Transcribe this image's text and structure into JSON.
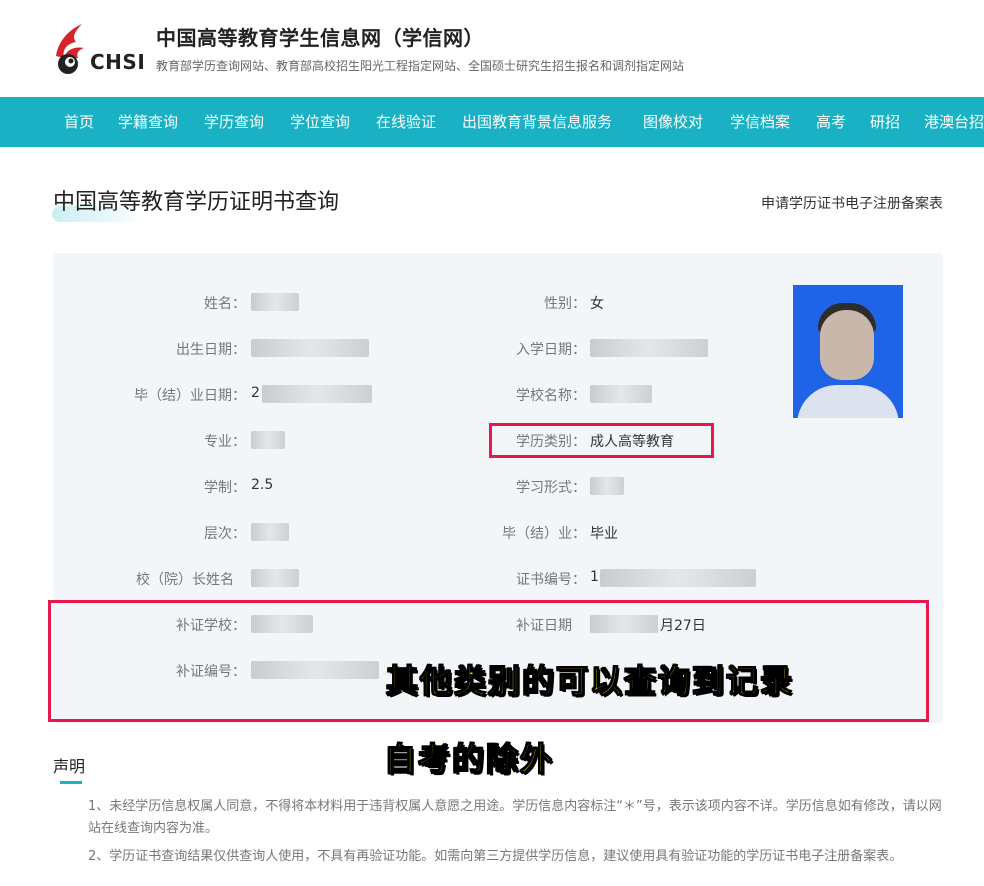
{
  "header": {
    "logo_text": "CHSI",
    "site_title": "中国高等教育学生信息网（学信网）",
    "site_subtitle": "教育部学历查询网站、教育部高校招生阳光工程指定网站、全国硕士研究生招生报名和调剂指定网站"
  },
  "nav": {
    "items": [
      "首页",
      "学籍查询",
      "学历查询",
      "学位查询",
      "在线验证",
      "出国教育背景信息服务",
      "图像校对",
      "学信档案",
      "高考",
      "研招",
      "港澳台招"
    ]
  },
  "page": {
    "title": "中国高等教育学历证明书查询",
    "right_link": "申请学历证书电子注册备案表"
  },
  "fields": {
    "name_label": "姓名：",
    "gender_label": "性别：",
    "gender_value": "女",
    "birth_label": "出生日期：",
    "enroll_label": "入学日期：",
    "grad_date_label": "毕（结）业日期：",
    "grad_date_prefix": "2",
    "school_label": "学校名称：",
    "major_label": "专业：",
    "edu_type_label": "学历类别：",
    "edu_type_value": "成人高等教育",
    "duration_label": "学制：",
    "duration_value": "2.5",
    "study_form_label": "学习形式：",
    "level_label": "层次：",
    "grad_status_label": "毕（结）业：",
    "grad_status_value": "毕业",
    "president_label": "校（院）长姓名",
    "cert_no_label": "证书编号：",
    "cert_no_prefix": "1",
    "reissue_school_label": "补证学校：",
    "reissue_date_label": "补证日期",
    "reissue_date_suffix": "月27日",
    "reissue_no_label": "补证编号："
  },
  "annotations": {
    "line1": "其他类别的可以查询到记录",
    "line2": "自考的除外"
  },
  "declaration": {
    "title": "声明",
    "items": [
      "1、未经学历信息权属人同意，不得将本材料用于违背权属人意愿之用途。学历信息内容标注“＊”号，表示该项内容不详。学历信息如有修改，请以网站在线查询内容为准。",
      "2、学历证书查询结果仅供查询人使用，不具有再验证功能。如需向第三方提供学历信息，建议使用具有验证功能的学历证书电子注册备案表。"
    ]
  },
  "colors": {
    "nav_bg": "#1ab1c4",
    "highlight_border": "#e8184f",
    "annotation_text": "#fff100",
    "logo_red": "#d8232a"
  }
}
